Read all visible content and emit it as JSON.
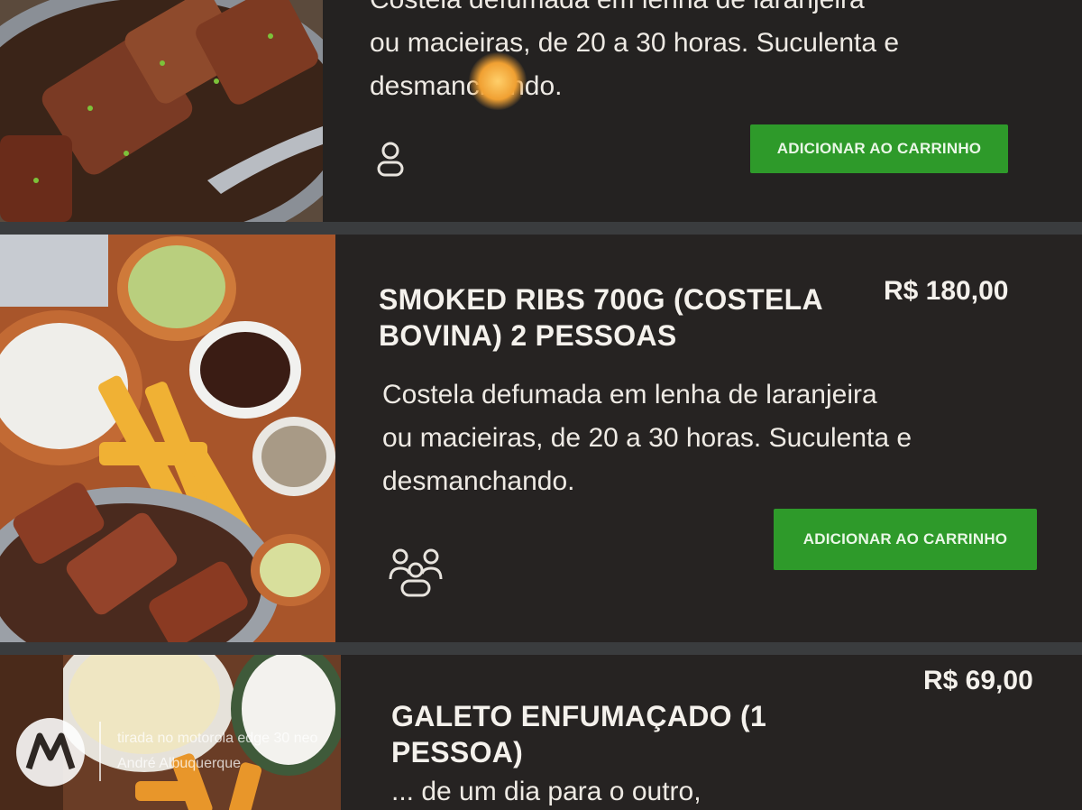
{
  "items": [
    {
      "title": "",
      "price": "",
      "description_lines": [
        "Costela defumada em lenha de laranjeira",
        "ou macieiras, de 20 a 30 horas. Suculenta e",
        "desmanchando."
      ],
      "button_label": "ADICIONAR AO CARRINHO",
      "serves_icon": "single-person-icon"
    },
    {
      "title_lines": [
        "SMOKED RIBS 700G (COSTELA",
        "BOVINA) 2 PESSOAS"
      ],
      "price": "R$ 180,00",
      "description_lines": [
        "Costela defumada em lenha de laranjeira",
        "ou macieiras, de 20 a 30 horas. Suculenta e",
        "desmanchando."
      ],
      "button_label": "ADICIONAR AO CARRINHO",
      "serves_icon": "group-people-icon"
    },
    {
      "title_lines": [
        "GALETO  ENFUMAÇADO (1",
        "PESSOA)"
      ],
      "price": "R$ 69,00",
      "description_lines": [
        "... de um dia para o outro,"
      ]
    }
  ],
  "watermark": {
    "line1": "tirada no motorola edge 30 neo",
    "line2": "André Albuquerque",
    "logo": "motorola-logo"
  },
  "colors": {
    "button": "#2e9a2a",
    "card": "#2a2725",
    "text": "#f4f1ec"
  }
}
